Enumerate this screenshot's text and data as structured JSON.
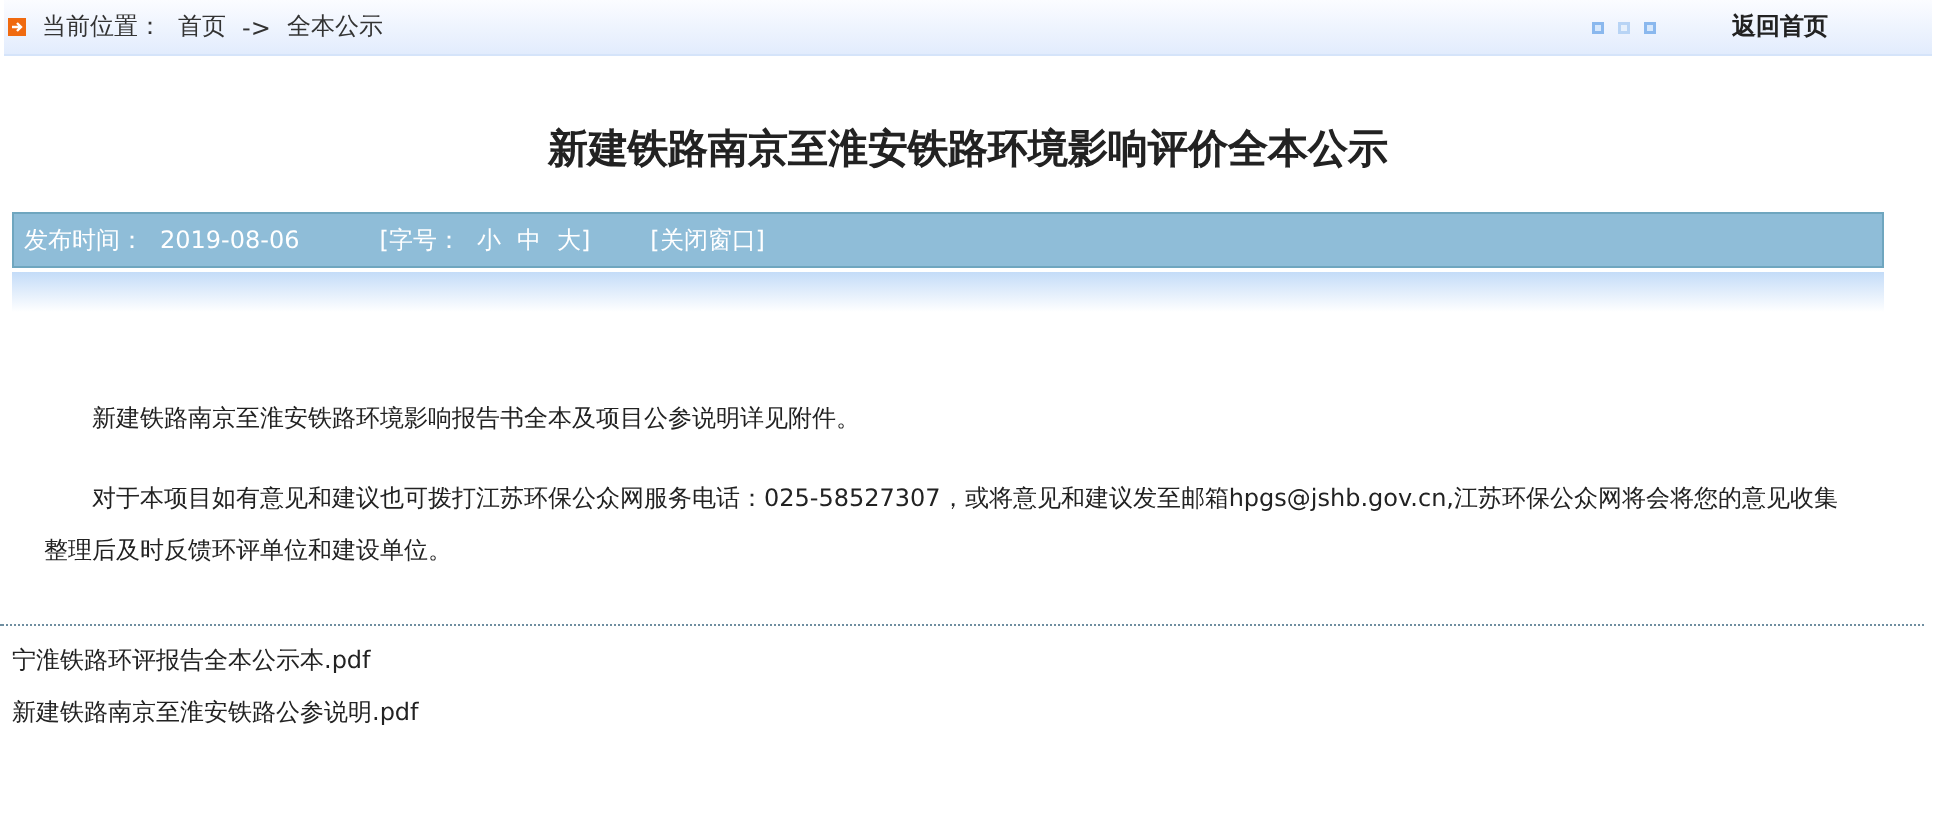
{
  "breadcrumb": {
    "label": "当前位置：",
    "home": "首页",
    "separator": "->",
    "current": "全本公示"
  },
  "back_link": "返回首页",
  "title": "新建铁路南京至淮安铁路环境影响评价全本公示",
  "info_bar": {
    "date_label": "发布时间：",
    "date": "2019-08-06",
    "font_size_label": "[字号：",
    "sizes": [
      "小",
      "中",
      "大"
    ],
    "font_size_end": "]",
    "close": "[关闭窗口]"
  },
  "paragraphs": [
    "新建铁路南京至淮安铁路环境影响报告书全本及项目公参说明详见附件。",
    "对于本项目如有意见和建议也可拨打江苏环保公众网服务电话：025-58527307，或将意见和建议发至邮箱hpgs@jshb.gov.cn,江苏环保公众网将会将您的意见收集整理后及时反馈环评单位和建设单位。"
  ],
  "attachments": [
    "宁淮铁路环评报告全本公示本.pdf",
    "新建铁路南京至淮安铁路公参说明.pdf"
  ]
}
